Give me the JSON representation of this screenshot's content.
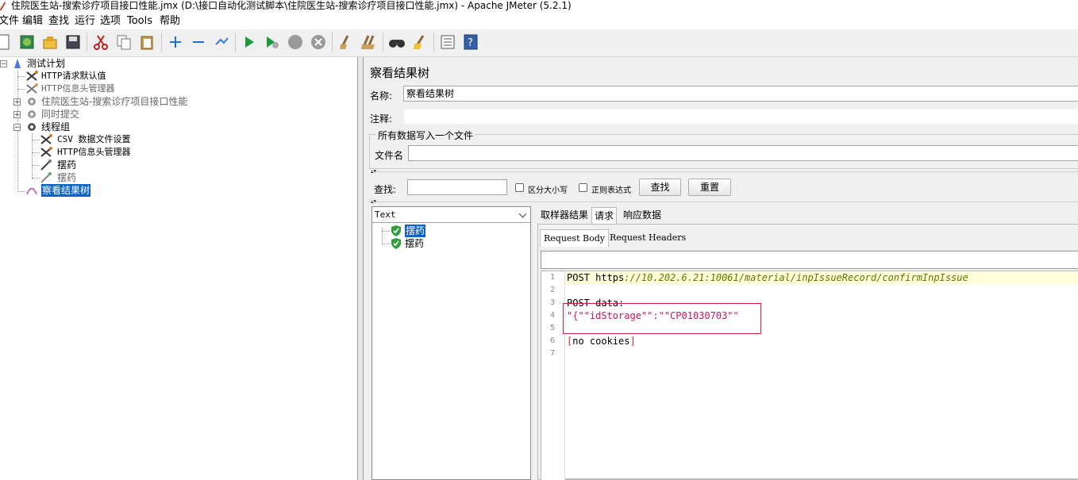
{
  "window": {
    "title": "住院医生站-搜索诊疗项目接口性能.jmx (D:\\接口自动化测试脚本\\住院医生站-搜索诊疗项目接口性能.jmx) - Apache JMeter (5.2.1)"
  },
  "menu": [
    "文件",
    "编辑",
    "查找",
    "运行",
    "选项",
    "Tools",
    "帮助"
  ],
  "toolbar": {
    "icons": [
      "new-icon",
      "templates-icon",
      "open-icon",
      "save-icon",
      "cut-icon",
      "copy-icon",
      "paste-icon",
      "expand-icon",
      "collapse-icon",
      "toggle-icon",
      "start-icon",
      "start-no-pause-icon",
      "stop-icon",
      "shutdown-icon",
      "clear-icon",
      "clear-all-icon",
      "search-icon",
      "reset-search-icon",
      "function-helper-icon",
      "help-icon"
    ]
  },
  "tree": {
    "items": [
      {
        "label": "测试计划"
      },
      {
        "label": "HTTP请求默认值"
      },
      {
        "label": "HTTP信息头管理器"
      },
      {
        "label": "住院医生站-搜索诊疗项目接口性能"
      },
      {
        "label": "同时提交"
      },
      {
        "label": "线程组"
      },
      {
        "label": "CSV 数据文件设置"
      },
      {
        "label": "HTTP信息头管理器"
      },
      {
        "label": "摆药"
      },
      {
        "label": "摆药"
      },
      {
        "label": "察看结果树"
      }
    ]
  },
  "panel": {
    "title": "察看结果树",
    "name_label": "名称:",
    "name_value": "察看结果树",
    "comment_label": "注释:",
    "comment_value": "",
    "file_group_legend": "所有数据写入一个文件",
    "filename_label": "文件名",
    "filename_value": ""
  },
  "search": {
    "label": "查找:",
    "value": "",
    "case_label": "区分大小写",
    "regex_label": "正则表达式",
    "find_button": "查找",
    "reset_button": "重置"
  },
  "results": {
    "renderer": "Text",
    "samples": [
      {
        "label": "摆药",
        "status": "success",
        "selected": true
      },
      {
        "label": "摆药",
        "status": "success",
        "selected": false
      }
    ],
    "tabs": [
      "取样器结果",
      "请求",
      "响应数据"
    ],
    "active_tab": "请求",
    "subtabs": [
      "Request Body",
      "Request Headers"
    ],
    "active_subtab": "Request Body",
    "lines": [
      {
        "num": "1",
        "parts": [
          {
            "text": "POST ",
            "color": "#000000"
          },
          {
            "text": "https",
            "color": "#000000"
          },
          {
            "text": "://10.202.6.21:10061/material/inpIssueRecord/confirmInpIssue",
            "color": "#5a7a00",
            "italic": true
          }
        ]
      },
      {
        "num": "2",
        "parts": []
      },
      {
        "num": "3",
        "parts": [
          {
            "text": "POST data:",
            "color": "#000000"
          }
        ]
      },
      {
        "num": "4",
        "parts": [
          {
            "text": "\"{\"\"idStorage\"\":\"\"CP01030703\"\"",
            "color": "#c2185b"
          }
        ]
      },
      {
        "num": "5",
        "parts": []
      },
      {
        "num": "6",
        "parts": [
          {
            "text": "[",
            "color": "#d32f2f"
          },
          {
            "text": "no cookies",
            "color": "#000000"
          },
          {
            "text": "]",
            "color": "#d32f2f"
          }
        ]
      },
      {
        "num": "7",
        "parts": []
      }
    ]
  },
  "colors": {
    "selection": "#0a64c8",
    "highlight_line": "#ffffd9",
    "annotation_box": "#d0213b",
    "success": "#2e9e3e"
  }
}
